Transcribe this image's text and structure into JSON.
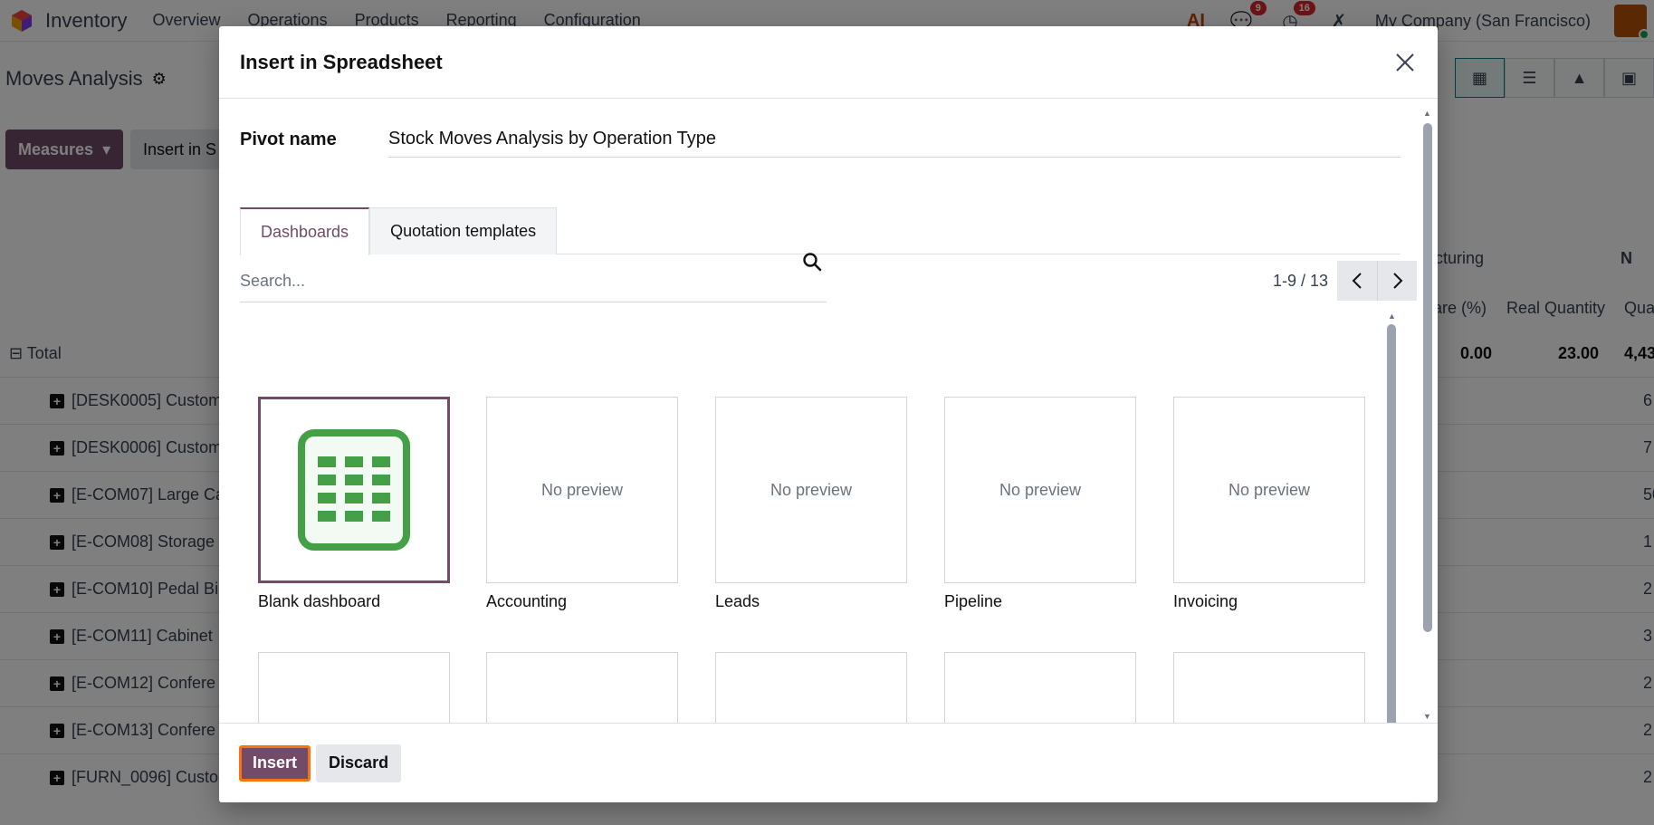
{
  "app": {
    "name": "Inventory",
    "menu": [
      "Overview",
      "Operations",
      "Products",
      "Reporting",
      "Configuration"
    ],
    "ai_label": "AI",
    "messages_count": "9",
    "activities_count": "16",
    "company": "My Company (San Francisco)"
  },
  "background": {
    "page_title": "Moves Analysis",
    "measures_label": "Measures",
    "insert_label": "Insert in S",
    "pivot_header_1": "cturing",
    "pivot_header_2": "N",
    "col_share": "are (%)",
    "col_real_qty": "Real Quantity",
    "col_qua": "Qua",
    "total_label": "Total",
    "total_share": "0.00",
    "total_real_qty": "23.00",
    "total_qua": "4,43",
    "rows": [
      {
        "label": "[DESK0005] Custom",
        "value": "6"
      },
      {
        "label": "[DESK0006] Custom",
        "value": "7"
      },
      {
        "label": "[E-COM07] Large Ca",
        "value": "50"
      },
      {
        "label": "[E-COM08] Storage",
        "value": "1"
      },
      {
        "label": "[E-COM10] Pedal Bi",
        "value": "2"
      },
      {
        "label": "[E-COM11] Cabinet",
        "value": "3"
      },
      {
        "label": "[E-COM12] Confere",
        "value": "2"
      },
      {
        "label": "[E-COM13] Confere",
        "value": "2"
      },
      {
        "label": "[FURN_0096] Custo",
        "value": "2"
      }
    ]
  },
  "dialog": {
    "title": "Insert in Spreadsheet",
    "pivot_name_label": "Pivot name",
    "pivot_name_value": "Stock Moves Analysis by Operation Type",
    "tabs": [
      "Dashboards",
      "Quotation templates"
    ],
    "search_placeholder": "Search...",
    "pager_value": "1-9 / 13",
    "no_preview": "No preview",
    "cards_row1": [
      "Blank dashboard",
      "Accounting",
      "Leads",
      "Pipeline",
      "Invoicing"
    ],
    "insert_label": "Insert",
    "discard_label": "Discard"
  },
  "colors": {
    "primary": "#714b67",
    "focus_ring": "#f97316",
    "spreadsheet_green": "#43a047"
  }
}
